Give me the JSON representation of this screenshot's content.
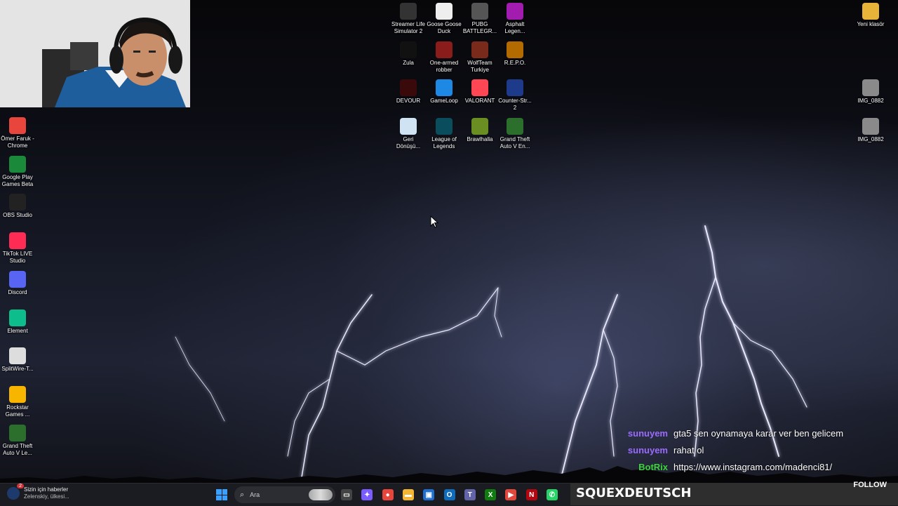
{
  "desktop": {
    "left_column": [
      {
        "label": "Ömer Faruk - Chrome",
        "icon": "chrome-icon",
        "color": "#e8453c"
      },
      {
        "label": "Google Play Games Beta",
        "icon": "google-play-games-icon",
        "color": "#1a8a3a"
      },
      {
        "label": "OBS Studio",
        "icon": "obs-icon",
        "color": "#222222"
      },
      {
        "label": "TikTok LIVE Studio",
        "icon": "tiktok-live-icon",
        "color": "#fe2c55"
      },
      {
        "label": "Discord",
        "icon": "discord-icon",
        "color": "#5865f2"
      },
      {
        "label": "Element",
        "icon": "element-icon",
        "color": "#0dbd8b"
      },
      {
        "label": "SplitWire-T...",
        "icon": "splitwire-icon",
        "color": "#dddddd"
      },
      {
        "label": "Rockstar Games ...",
        "icon": "rockstar-icon",
        "color": "#f7b500"
      },
      {
        "label": "Grand Theft Auto V Le...",
        "icon": "gta-v-icon",
        "color": "#2c6e2c"
      }
    ],
    "grid": [
      {
        "label": "Streamer Life Simulator 2",
        "icon": "streamer-life-icon",
        "color": "#333333"
      },
      {
        "label": "Goose Goose Duck",
        "icon": "goose-goose-duck-icon",
        "color": "#eeeeee"
      },
      {
        "label": "PUBG BATTLEGR...",
        "icon": "pubg-icon",
        "color": "#555555"
      },
      {
        "label": "Asphalt Legen...",
        "icon": "asphalt-icon",
        "color": "#a21caf"
      },
      {
        "label": "Zula",
        "icon": "zula-icon",
        "color": "#111111"
      },
      {
        "label": "One-armed robber",
        "icon": "one-armed-robber-icon",
        "color": "#8b1c1c"
      },
      {
        "label": "WolfTeam Turkiye",
        "icon": "wolfteam-icon",
        "color": "#7a2a1a"
      },
      {
        "label": "R.E.P.O.",
        "icon": "repo-icon",
        "color": "#b36b00"
      },
      {
        "label": "DEVOUR",
        "icon": "devour-icon",
        "color": "#3a0a0a"
      },
      {
        "label": "GameLoop",
        "icon": "gameloop-icon",
        "color": "#1e88e5"
      },
      {
        "label": "VALORANT",
        "icon": "valorant-icon",
        "color": "#ff4655"
      },
      {
        "label": "Counter-Str... 2",
        "icon": "counter-strike-icon",
        "color": "#1e3a8a"
      },
      {
        "label": "Geri Dönüşü...",
        "icon": "recycle-bin-icon",
        "color": "#cfe3f3"
      },
      {
        "label": "League of Legends",
        "icon": "league-of-legends-icon",
        "color": "#0a4d5c"
      },
      {
        "label": "Brawlhalla",
        "icon": "brawlhalla-icon",
        "color": "#6b8e23"
      },
      {
        "label": "Grand Theft Auto V En...",
        "icon": "gta-v-icon",
        "color": "#2c6e2c"
      }
    ],
    "right_column": [
      {
        "label": "Yeni klasör",
        "icon": "folder-icon",
        "color": "#e8b339"
      },
      {
        "label": "IMG_0882",
        "icon": "image-file-icon",
        "color": "#8a8a8a"
      },
      {
        "label": "IMG_0882",
        "icon": "image-file-icon",
        "color": "#8a8a8a"
      }
    ]
  },
  "chat": [
    {
      "user": "sunuyem",
      "user_color": "#9b6bff",
      "message": "gta5 sen oynamaya karar ver ben gelicem"
    },
    {
      "user": "sunuyem",
      "user_color": "#9b6bff",
      "message": "rahat ol"
    },
    {
      "user": "BotRix",
      "user_color": "#3ad33a",
      "message": "https://www.instagram.com/madenci81/"
    }
  ],
  "taskbar": {
    "news_title": "Sizin için haberler",
    "news_subtitle": "Zelenskiy, ülkesi...",
    "news_badge": "2",
    "search_placeholder": "Ara",
    "apps": [
      {
        "name": "task-view-icon",
        "color": "#444444",
        "glyph": "▭"
      },
      {
        "name": "copilot-icon",
        "color": "#7b5cff",
        "glyph": "✦"
      },
      {
        "name": "chrome-icon",
        "color": "#e8453c",
        "glyph": "●"
      },
      {
        "name": "file-explorer-icon",
        "color": "#f2b632",
        "glyph": "▬"
      },
      {
        "name": "store-icon",
        "color": "#1f6fd1",
        "glyph": "▣"
      },
      {
        "name": "outlook-icon",
        "color": "#0f6cbd",
        "glyph": "O"
      },
      {
        "name": "teams-icon",
        "color": "#6264a7",
        "glyph": "T"
      },
      {
        "name": "xbox-icon",
        "color": "#107c10",
        "glyph": "X"
      },
      {
        "name": "google-play-games-icon",
        "color": "#e0483e",
        "glyph": "▶"
      },
      {
        "name": "netflix-icon",
        "color": "#b20710",
        "glyph": "N"
      },
      {
        "name": "whatsapp-icon",
        "color": "#25d366",
        "glyph": "✆"
      }
    ]
  },
  "follow_bar": {
    "streamer": "SQUEXDEUTSCH",
    "label": "FOLLOW"
  }
}
